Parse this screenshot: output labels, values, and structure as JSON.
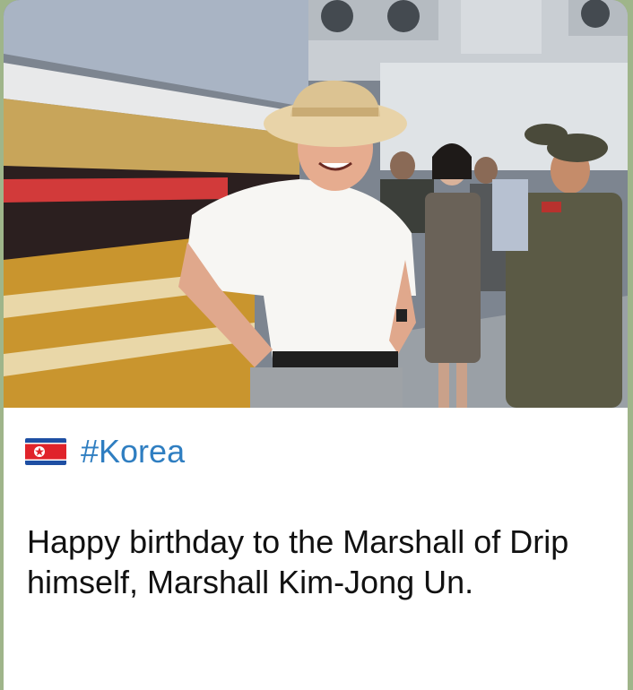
{
  "post": {
    "image_alt": "Photo of a smiling man in a straw hat and white shirt standing in a warehouse stocked with bottles and jars, with uniformed officers behind him",
    "hashtag": "#Korea",
    "flag_icon": "north-korea-flag-icon",
    "message": "Happy birthday to the Marshall of Drip himself, Marshall Kim-Jong Un."
  },
  "colors": {
    "chat_background": "#9fb58a",
    "bubble": "#ffffff",
    "link": "#2f7ec1",
    "text": "#111111"
  }
}
